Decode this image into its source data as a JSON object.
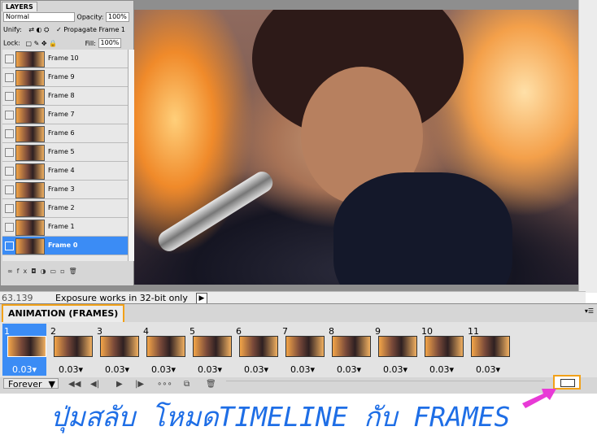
{
  "layers_panel": {
    "tab_label": "LAYERS",
    "blend_mode": "Normal",
    "opacity_label": "Opacity:",
    "opacity_value": "100%",
    "unify_label": "Unify:",
    "propagate_label": "Propagate Frame 1",
    "lock_label": "Lock:",
    "fill_label": "Fill:",
    "fill_value": "100%",
    "layers": [
      {
        "name": "Frame 10"
      },
      {
        "name": "Frame 9"
      },
      {
        "name": "Frame 8"
      },
      {
        "name": "Frame 7"
      },
      {
        "name": "Frame 6"
      },
      {
        "name": "Frame 5"
      },
      {
        "name": "Frame 4"
      },
      {
        "name": "Frame 3"
      },
      {
        "name": "Frame 2"
      },
      {
        "name": "Frame 1"
      },
      {
        "name": "Frame 0",
        "selected": true
      }
    ],
    "footer_icons": [
      "link-icon",
      "fx-icon",
      "mask-icon",
      "adjustment-icon",
      "group-icon",
      "new-layer-icon",
      "trash-icon"
    ]
  },
  "status_bar": {
    "zoom": "63.139",
    "message": "Exposure works in 32-bit only"
  },
  "animation_panel": {
    "tab_label": "ANIMATION (FRAMES)",
    "frames": [
      {
        "num": "1",
        "delay": "0.03",
        "selected": true
      },
      {
        "num": "2",
        "delay": "0.03"
      },
      {
        "num": "3",
        "delay": "0.03"
      },
      {
        "num": "4",
        "delay": "0.03"
      },
      {
        "num": "5",
        "delay": "0.03"
      },
      {
        "num": "6",
        "delay": "0.03"
      },
      {
        "num": "7",
        "delay": "0.03"
      },
      {
        "num": "8",
        "delay": "0.03"
      },
      {
        "num": "9",
        "delay": "0.03"
      },
      {
        "num": "10",
        "delay": "0.03"
      },
      {
        "num": "11",
        "delay": "0.03"
      }
    ],
    "loop_option": "Forever",
    "controls": [
      "first-frame-icon",
      "prev-frame-icon",
      "play-icon",
      "next-frame-icon",
      "tween-icon",
      "duplicate-frame-icon",
      "delete-frame-icon"
    ]
  },
  "caption": {
    "text": "ปุ่มสลับ โหมดTIMELINE กับ FRAMES",
    "color": "#1e6ee6"
  },
  "accent_colors": {
    "highlight_border": "#f2a118",
    "selection": "#3b8cf5",
    "arrow": "#e83ad6"
  }
}
